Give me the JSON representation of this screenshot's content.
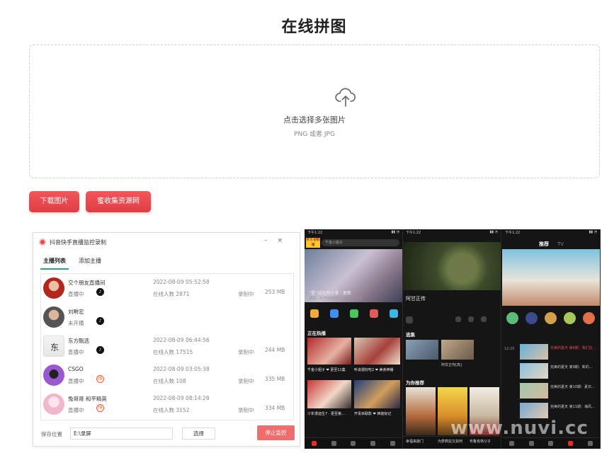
{
  "page": {
    "title": "在线拼图"
  },
  "dropzone": {
    "main_text": "点击选择多张图片",
    "hint_text": "PNG 或者 JPG"
  },
  "buttons": {
    "download": "下载图片",
    "collect": "蜜收集资源网"
  },
  "recorder_window": {
    "title": "抖音快手直播监控录制",
    "tabs": [
      "主播列表",
      "添加主播"
    ],
    "rows": [
      {
        "name": "交个朋友直播间",
        "status": "直播中",
        "platform": "douyin",
        "time": "2022-08-09 05:52:58",
        "viewers": "在线人数 2871",
        "rec": "录制中",
        "size": "253 MB"
      },
      {
        "name": "刘畊宏",
        "status": "未开播",
        "platform": "douyin",
        "time": "",
        "viewers": "",
        "rec": "",
        "size": ""
      },
      {
        "name": "东方甄选",
        "status": "直播中",
        "platform": "douyin",
        "time": "2022-08-09 06:44:56",
        "viewers": "在线人数 17515",
        "rec": "录制中",
        "size": "244 MB"
      },
      {
        "name": "CSGO",
        "status": "直播中",
        "platform": "kuaishou",
        "time": "2022-08-09 03:05:38",
        "viewers": "在线人数 108",
        "rec": "录制中",
        "size": "335 MB"
      },
      {
        "name": "兔哥哥 和平精英",
        "status": "直播中",
        "platform": "kuaishou",
        "time": "2022-08-09 08:14:28",
        "viewers": "在线人数 3152",
        "rec": "录制中",
        "size": "334 MB"
      }
    ],
    "footer": {
      "save_label": "保存位置",
      "save_path": "E:\\录屏",
      "browse": "选择",
      "stop": "停止监控"
    }
  },
  "phones": {
    "p1": {
      "time": "下午1:22",
      "search": "千金小姐子",
      "badge": "学习\n好料铺",
      "headline": "“星”动这件小事 · 更新",
      "subline": "源泉，从开始就散开之前晚一节课",
      "section": "正在热播",
      "card1": "千金小姐子 ❤ 更至11集",
      "card2": "听说很好吃2 ❤ 美食神播",
      "card3": "少年漫迪生7 · 更至第…",
      "card4": "开青目联影 ❤ 西装标记"
    },
    "p2": {
      "time": "下午1:22",
      "title": "阿甘正传",
      "section": "选集",
      "ep_label": "阿甘正传[高]",
      "section2": "为你推荐",
      "rec1": "幸福来敲门",
      "rec2": "为梦疯狂又如何",
      "rec3": "布鲁克林父子"
    },
    "p3": {
      "time": "下午1:22",
      "tab_active": "推荐",
      "tab_dim": "TV",
      "eps": [
        {
          "time": "12:25",
          "text": "完美的夏天 第8期：我们在…",
          "hl": true
        },
        {
          "time": "",
          "text": "完美的夏天 第9期：新的…",
          "hl": false
        },
        {
          "time": "",
          "text": "完美的夏天 第10期：夏日…",
          "hl": false
        },
        {
          "time": "",
          "text": "完美的夏天 第11期：海风…",
          "hl": false
        }
      ]
    }
  },
  "watermark": "www.nuvi.cc",
  "colors": {
    "accent_red": "#e03d44",
    "tab_green": "#2aa67a"
  }
}
